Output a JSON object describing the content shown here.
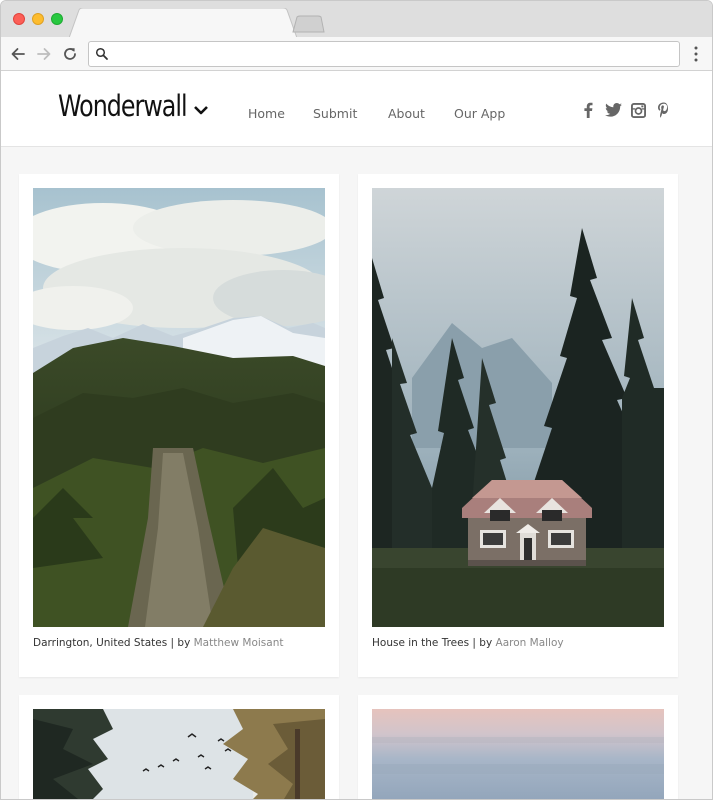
{
  "browser": {
    "url": "",
    "icons": {
      "back": "back-arrow-icon",
      "forward": "forward-arrow-icon",
      "reload": "reload-icon",
      "search": "search-icon",
      "menu": "more-vert-icon"
    }
  },
  "site": {
    "logo": "Wonderwall",
    "nav": [
      {
        "label": "Home"
      },
      {
        "label": "Submit"
      },
      {
        "label": "About"
      },
      {
        "label": "Our App"
      }
    ],
    "social": [
      {
        "icon": "facebook-icon"
      },
      {
        "icon": "twitter-icon"
      },
      {
        "icon": "instagram-icon"
      },
      {
        "icon": "pinterest-icon"
      }
    ]
  },
  "posts": [
    {
      "location": "Darrington, United States",
      "separator": " | by ",
      "author": "Matthew Moisant"
    },
    {
      "location": "House in the Trees",
      "separator": " | by ",
      "author": "Aaron Malloy"
    },
    {
      "location": "",
      "separator": "",
      "author": ""
    },
    {
      "location": "",
      "separator": "",
      "author": ""
    }
  ],
  "colors": {
    "page_bg": "#f6f6f6",
    "card_bg": "#ffffff",
    "author_link": "#888888",
    "nav_text": "#666666"
  }
}
